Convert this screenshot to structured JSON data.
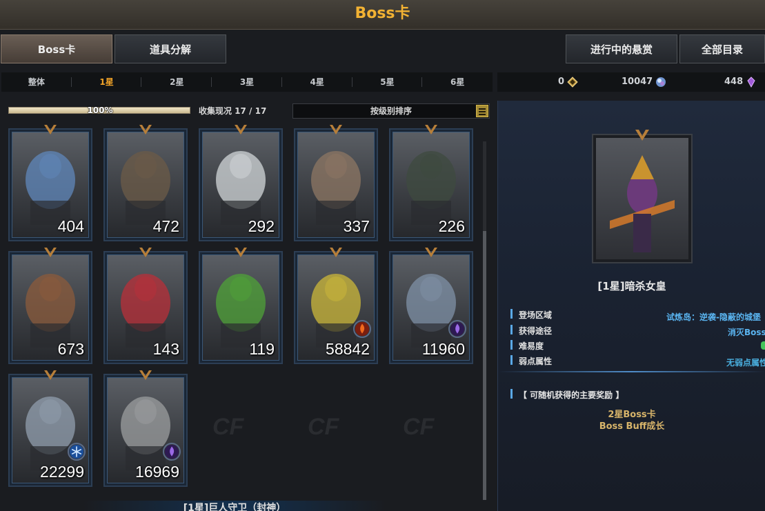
{
  "title": "Boss卡",
  "tabs": {
    "boss_card": "Boss卡",
    "decompose": "道具分解",
    "bounty": "进行中的悬赏",
    "catalog": "全部目录"
  },
  "stars": [
    "整体",
    "1星",
    "2星",
    "3星",
    "4星",
    "5星",
    "6星"
  ],
  "selected_star_index": 1,
  "currency": [
    {
      "value": "0",
      "icon": "gold-diamond-icon",
      "color": "#c9a24a"
    },
    {
      "value": "10047",
      "icon": "crystal-orb-icon",
      "color": "#8fb6e8"
    },
    {
      "value": "448",
      "icon": "purple-gem-icon",
      "color": "#a05ad8"
    }
  ],
  "progress": {
    "label": "100%",
    "fraction": 1.0
  },
  "collection": "收集现况 17 / 17",
  "sort": {
    "label": "按级别排序"
  },
  "cards": [
    {
      "count": "404",
      "art_color": "#5f86b8",
      "element": null
    },
    {
      "count": "472",
      "art_color": "#6b5a48",
      "element": null
    },
    {
      "count": "292",
      "art_color": "#cfd3d6",
      "element": null
    },
    {
      "count": "337",
      "art_color": "#8c7563",
      "element": null
    },
    {
      "count": "226",
      "art_color": "#3e4a3f",
      "element": null
    },
    {
      "count": "673",
      "art_color": "#8a5a3c",
      "element": null
    },
    {
      "count": "143",
      "art_color": "#b6303a",
      "element": null
    },
    {
      "count": "119",
      "art_color": "#4fa038",
      "element": null
    },
    {
      "count": "58842",
      "art_color": "#c9b53a",
      "element": "fire-icon"
    },
    {
      "count": "11960",
      "art_color": "#7e8fa4",
      "element": "dark-flame-icon"
    },
    {
      "count": "22299",
      "art_color": "#8f9cab",
      "element": "ice-icon"
    },
    {
      "count": "16969",
      "art_color": "#9a9c9e",
      "element": "dark-flame-icon"
    }
  ],
  "bottom_label": "[1星]巨人守卫（封神）",
  "detail": {
    "name": "[1星]暗杀女皇",
    "rows": [
      {
        "label": "登场区域",
        "value": "试炼岛：逆袭-隐蔽的城堡"
      },
      {
        "label": "获得途径",
        "value": "消灭Boss"
      },
      {
        "label": "难易度",
        "value": ""
      },
      {
        "label": "弱点属性",
        "value": "无弱点属性"
      }
    ],
    "reward_title": "【 可随机获得的主要奖励 】",
    "rewards": [
      "2星Boss卡",
      "Boss Buff成长"
    ]
  }
}
